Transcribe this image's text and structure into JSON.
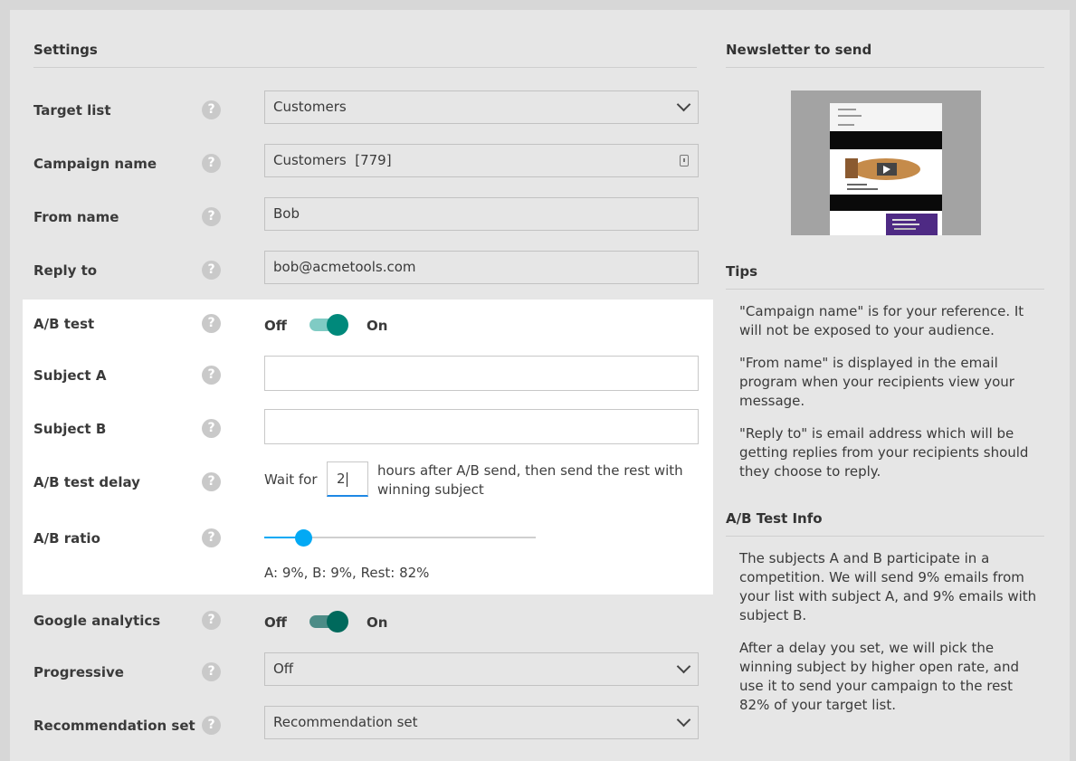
{
  "settings": {
    "title": "Settings",
    "rows": {
      "target_list": {
        "label": "Target list",
        "value": "Customers"
      },
      "campaign_name": {
        "label": "Campaign name",
        "value": "Customers  [779]"
      },
      "from_name": {
        "label": "From name",
        "value": "Bob"
      },
      "reply_to": {
        "label": "Reply to",
        "value": "bob@acmetools.com"
      },
      "ab_test": {
        "label": "A/B test",
        "off": "Off",
        "on": "On",
        "enabled": true
      },
      "subject_a": {
        "label": "Subject A",
        "value": ""
      },
      "subject_b": {
        "label": "Subject B",
        "value": ""
      },
      "ab_delay": {
        "label": "A/B test delay",
        "prefix": "Wait for",
        "value": "2",
        "suffix": "hours after A/B send, then send the rest with winning subject"
      },
      "ab_ratio": {
        "label": "A/B ratio",
        "value": 9,
        "summary": "A: 9%, B: 9%, Rest: 82%"
      },
      "google_analytics": {
        "label": "Google analytics",
        "off": "Off",
        "on": "On",
        "enabled": true
      },
      "progressive": {
        "label": "Progressive",
        "value": "Off"
      },
      "recommendation": {
        "label": "Recommendation set",
        "value": "Recommendation set"
      }
    },
    "help_glyph": "?"
  },
  "newsletter": {
    "title": "Newsletter to send"
  },
  "tips": {
    "title": "Tips",
    "items": [
      "\"Campaign name\" is for your reference. It will not be exposed to your audience.",
      "\"From name\" is displayed in the email program when your recipients view your message.",
      "\"Reply to\" is email address which will be getting replies from your recipients should they choose to reply."
    ]
  },
  "ab_info": {
    "title": "A/B Test Info",
    "items": [
      "The subjects A and B participate in a competition. We will send 9% emails from your list with subject A, and 9% emails with subject B.",
      "After a delay you set, we will pick the winning subject by higher open rate, and use it to send your campaign to the rest 82% of your target list."
    ]
  },
  "colors": {
    "accent": "#00897b",
    "accent_light": "#80cbc4",
    "slider": "#03a9f4"
  },
  "icons": [
    "help-icon",
    "chevron-down-icon",
    "lock-icon",
    "toggle-switch",
    "slider-thumb"
  ]
}
